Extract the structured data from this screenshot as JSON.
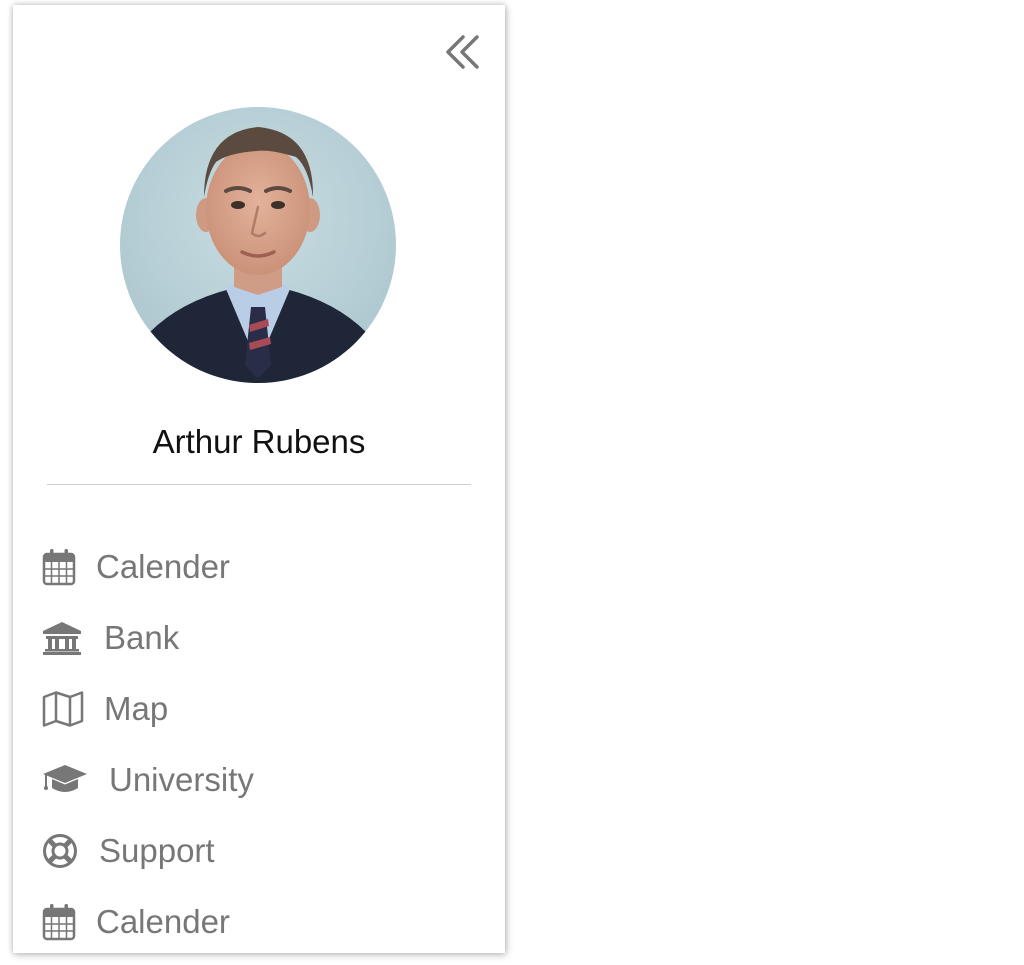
{
  "user": {
    "name": "Arthur Rubens",
    "avatar_icon": "profile-photo"
  },
  "header": {
    "collapse_icon": "double-chevron-left-icon"
  },
  "menu": {
    "items": [
      {
        "label": "Calender",
        "icon": "calendar-icon"
      },
      {
        "label": "Bank",
        "icon": "bank-icon"
      },
      {
        "label": "Map",
        "icon": "map-icon"
      },
      {
        "label": "University",
        "icon": "graduation-cap-icon"
      },
      {
        "label": "Support",
        "icon": "life-ring-icon"
      },
      {
        "label": "Calender",
        "icon": "calendar-icon"
      }
    ]
  },
  "colors": {
    "menu_text": "#777777",
    "name_text": "#111111",
    "divider": "#cfcfcf"
  }
}
